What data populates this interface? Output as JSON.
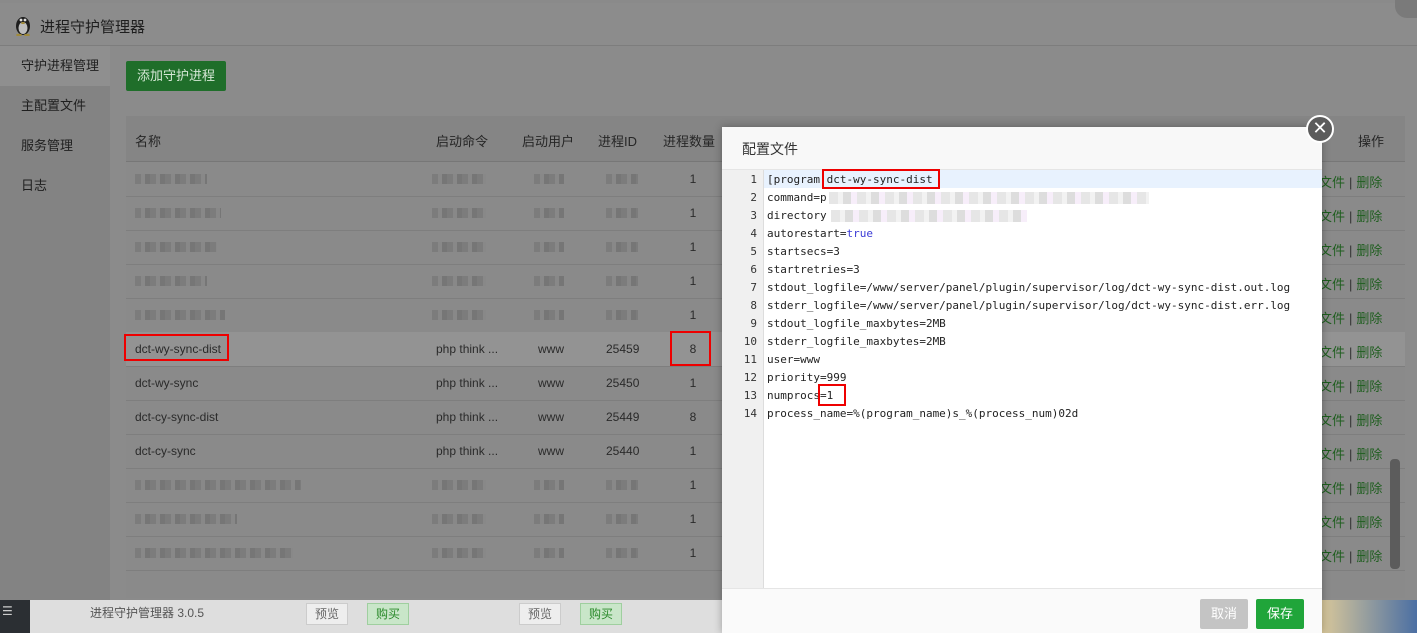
{
  "window": {
    "title": "进程守护管理器"
  },
  "sidebar": {
    "items": [
      {
        "label": "守护进程管理"
      },
      {
        "label": "主配置文件"
      },
      {
        "label": "服务管理"
      },
      {
        "label": "日志"
      }
    ]
  },
  "toolbar": {
    "add_label": "添加守护进程"
  },
  "table": {
    "headers": [
      "名称",
      "启动命令",
      "启动用户",
      "进程ID",
      "进程数量",
      "操作"
    ],
    "rows": [
      {
        "name": "dct-wy-sync-dist",
        "cmd": "php think ...",
        "user": "www",
        "pid": "25459",
        "count": "8"
      },
      {
        "name": "dct-wy-sync",
        "cmd": "php think ...",
        "user": "www",
        "pid": "25450",
        "count": "1"
      },
      {
        "name": "dct-cy-sync-dist",
        "cmd": "php think ...",
        "user": "www",
        "pid": "25449",
        "count": "8"
      },
      {
        "name": "dct-cy-sync",
        "cmd": "php think ...",
        "user": "www",
        "pid": "25440",
        "count": "1"
      }
    ],
    "blurred_counts": [
      "1",
      "1",
      "1",
      "1",
      "1"
    ],
    "blurred_counts_bottom": [
      "1",
      "1",
      "1"
    ],
    "op_file": "文件",
    "op_sep": "|",
    "op_delete": "删除"
  },
  "modal": {
    "title": "配置文件",
    "lines": [
      "[program:dct-wy-sync-dist",
      "command=p",
      "directory",
      "autorestart=",
      "startsecs=3",
      "startretries=3",
      "stdout_logfile=/www/server/panel/plugin/supervisor/log/dct-wy-sync-dist.out.log",
      "stderr_logfile=/www/server/panel/plugin/supervisor/log/dct-wy-sync-dist.err.log",
      "stdout_logfile_maxbytes=2MB",
      "stderr_logfile_maxbytes=2MB",
      "user=www",
      "priority=999",
      "numprocs=1",
      "process_name=%(program_name)s_%(process_num)02d"
    ],
    "keyword_true": "true",
    "cancel_label": "取消",
    "save_label": "保存",
    "close_glyph": "✕"
  },
  "footer": {
    "version": "进程守护管理器 3.0.5",
    "preview_label": "预览",
    "buy_label": "购买"
  }
}
